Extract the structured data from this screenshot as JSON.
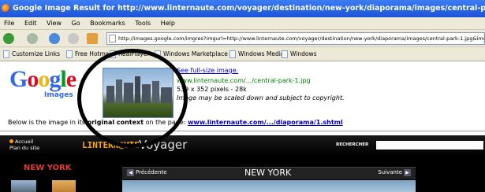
{
  "window": {
    "title": "Google Image Result for http://www.linternaute.com/voyager/destination/new-york/diaporama/images/central-park-1.jpg - Mozilla Firefox"
  },
  "menu": [
    "File",
    "Edit",
    "View",
    "Go",
    "Bookmarks",
    "Tools",
    "Help"
  ],
  "navbar": {
    "url": "http://images.google.com/imgres?imgurl=http://www.linternaute.com/voyager/destination/new-york/diaporama/images/central-park-1.jpg&imgre"
  },
  "bookmarks": [
    "Customize Links",
    "Free Hotmail",
    "RealPlayer",
    "Windows Marketplace",
    "Windows Media",
    "Windows"
  ],
  "google": {
    "logo_letters": [
      "G",
      "o",
      "o",
      "g",
      "l",
      "e"
    ],
    "images_label": "Images"
  },
  "result": {
    "see_full": "See full-size image.",
    "source_url": "www.linternaute.com/.../central-park-1.jpg",
    "dimensions": "539 x 352 pixels - 28k",
    "note": "Image may be scaled down and subject to copyright."
  },
  "context": {
    "prefix": "Below is the image in its",
    "bold": "original context",
    "middle": "on the page:",
    "link": "www.linternaute.com/.../diaporama/1.shtml"
  },
  "site": {
    "accueil": "Accueil",
    "plan": "Plan du site",
    "logo": "LINTERN@UTE",
    "section": "Voyager",
    "search_label": "RECHERCHER",
    "city_left": "NEW YORK",
    "prev": "Précédente",
    "title": "NEW YORK",
    "next": "Suivante"
  }
}
